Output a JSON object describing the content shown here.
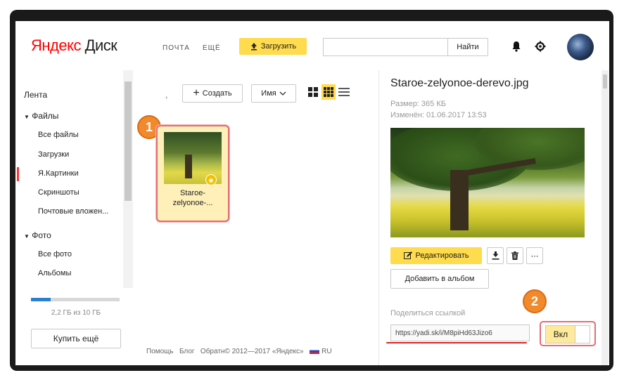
{
  "header": {
    "logo_main": "Яндекс",
    "logo_sub": "Диск",
    "nav_mail": "ПОЧТА",
    "nav_more": "ЕЩЁ",
    "upload_label": "Загрузить",
    "search_placeholder": "",
    "find_label": "Найти"
  },
  "sidebar": {
    "feed": "Лента",
    "files": "Файлы",
    "file_items": [
      "Все файлы",
      "Загрузки",
      "Я.Картинки",
      "Скриншоты",
      "Почтовые вложен..."
    ],
    "photo": "Фото",
    "photo_items": [
      "Все фото",
      "Альбомы"
    ],
    "storage_text": "2,2 ГБ из 10 ГБ",
    "storage_used_fraction": 0.22,
    "buy_label": "Купить ещё"
  },
  "toolbar": {
    "comma": ",",
    "create_label": "Создать",
    "sort_label": "Имя"
  },
  "file": {
    "name_line1": "Staroe-",
    "name_line2": "zelyonoe-..."
  },
  "markers": {
    "one": "1",
    "two": "2"
  },
  "footer": {
    "help": "Помощь",
    "blog": "Блог",
    "feedback": "Обратн",
    "copyright": "© 2012—2017 «Яндекс»",
    "lang": "RU"
  },
  "panel": {
    "title": "Staroe-zelyonoe-derevo.jpg",
    "size": "Размер: 365 КБ",
    "modified": "Изменён: 01.06.2017 13:53",
    "edit_label": "Редактировать",
    "album_label": "Добавить в альбом",
    "share_label": "Поделиться ссылкой",
    "share_link": "https://yadi.sk/i/M8piHd63Jizo6",
    "toggle_label": "Вкл"
  },
  "colors": {
    "accent": "#ffdb4d",
    "brand_red": "#ff0000",
    "marker": "#f28a2c"
  }
}
